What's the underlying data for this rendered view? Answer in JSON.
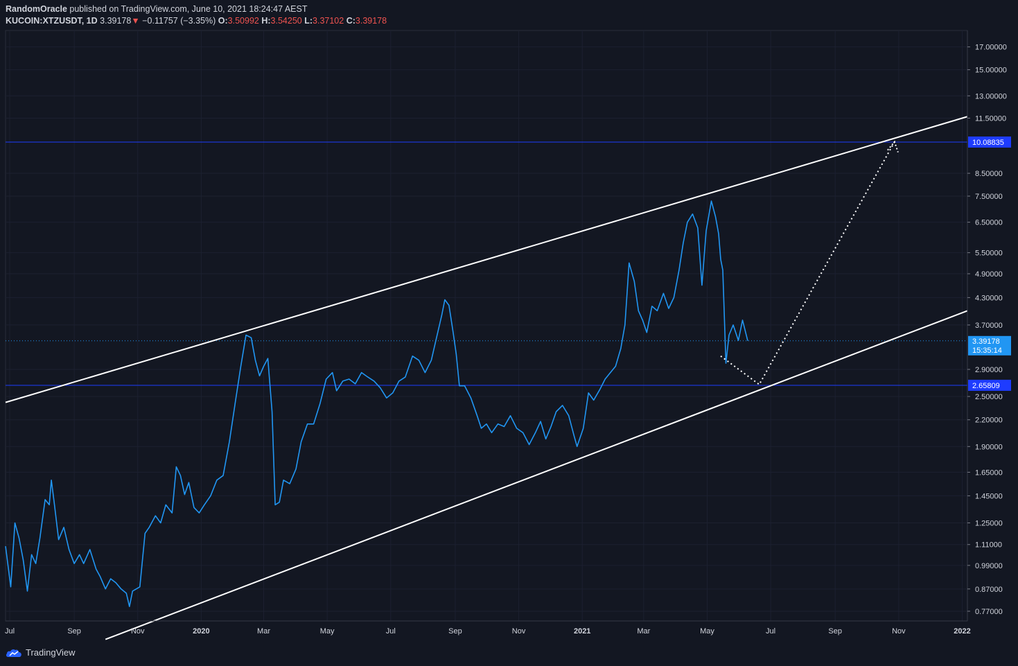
{
  "header": {
    "author": "RandomOracle",
    "published_text": "published on TradingView.com, June 10, 2021 18:24:47 AEST",
    "symbol": "KUCOIN:XTZUSDT, 1D",
    "last": "3.39178",
    "change_arrow": "▼",
    "change": "−0.11757 (−3.35%)",
    "o_label": "O:",
    "o_value": "3.50992",
    "h_label": "H:",
    "h_value": "3.54250",
    "l_label": "L:",
    "l_value": "3.37102",
    "c_label": "C:",
    "c_value": "3.39178"
  },
  "footer": {
    "brand": "TradingView"
  },
  "colors": {
    "background": "#131722",
    "price_line": "#2196f3",
    "horizontal_line": "#1e3cff",
    "channel": "#ffffff",
    "text": "#d1d4dc",
    "red": "#ef5350"
  },
  "chart_data": {
    "type": "line",
    "scale": "log",
    "grid": true,
    "x_ticks": [
      "Jul",
      "Sep",
      "Nov",
      "2020",
      "Mar",
      "May",
      "Jul",
      "Sep",
      "Nov",
      "2021",
      "Mar",
      "May",
      "Jul",
      "Sep",
      "Nov",
      "2022"
    ],
    "x_tick_dates": [
      "2019-07-01",
      "2019-09-01",
      "2019-11-01",
      "2020-01-01",
      "2020-03-01",
      "2020-05-01",
      "2020-07-01",
      "2020-09-01",
      "2020-11-01",
      "2021-01-01",
      "2021-03-01",
      "2021-05-01",
      "2021-07-01",
      "2021-09-01",
      "2021-11-01",
      "2022-01-01"
    ],
    "y_ticks": [
      "17.00000",
      "15.00000",
      "13.00000",
      "11.50000",
      "8.50000",
      "7.50000",
      "6.50000",
      "5.50000",
      "4.90000",
      "4.30000",
      "3.70000",
      "2.90000",
      "2.50000",
      "2.20000",
      "1.90000",
      "1.65000",
      "1.45000",
      "1.25000",
      "1.11000",
      "0.99000",
      "0.87000",
      "0.77000"
    ],
    "x_range": [
      "2019-06-27",
      "2022-01-06"
    ],
    "y_range": [
      0.73,
      18.6
    ],
    "series": [
      {
        "type": "line",
        "points": [
          [
            "2019-06-27",
            1.1
          ],
          [
            "2019-07-02",
            0.88
          ],
          [
            "2019-07-06",
            1.25
          ],
          [
            "2019-07-10",
            1.15
          ],
          [
            "2019-07-14",
            1.02
          ],
          [
            "2019-07-18",
            0.86
          ],
          [
            "2019-07-22",
            1.05
          ],
          [
            "2019-07-26",
            1.0
          ],
          [
            "2019-07-30",
            1.15
          ],
          [
            "2019-08-04",
            1.42
          ],
          [
            "2019-08-08",
            1.38
          ],
          [
            "2019-08-10",
            1.58
          ],
          [
            "2019-08-13",
            1.38
          ],
          [
            "2019-08-17",
            1.14
          ],
          [
            "2019-08-22",
            1.22
          ],
          [
            "2019-08-27",
            1.08
          ],
          [
            "2019-09-01",
            1.0
          ],
          [
            "2019-09-06",
            1.05
          ],
          [
            "2019-09-10",
            1.0
          ],
          [
            "2019-09-16",
            1.08
          ],
          [
            "2019-09-22",
            0.97
          ],
          [
            "2019-09-26",
            0.93
          ],
          [
            "2019-10-01",
            0.87
          ],
          [
            "2019-10-06",
            0.92
          ],
          [
            "2019-10-11",
            0.9
          ],
          [
            "2019-10-16",
            0.87
          ],
          [
            "2019-10-21",
            0.85
          ],
          [
            "2019-10-24",
            0.79
          ],
          [
            "2019-10-27",
            0.86
          ],
          [
            "2019-11-03",
            0.88
          ],
          [
            "2019-11-08",
            1.18
          ],
          [
            "2019-11-12",
            1.22
          ],
          [
            "2019-11-18",
            1.3
          ],
          [
            "2019-11-23",
            1.25
          ],
          [
            "2019-11-28",
            1.38
          ],
          [
            "2019-12-04",
            1.32
          ],
          [
            "2019-12-08",
            1.7
          ],
          [
            "2019-12-12",
            1.62
          ],
          [
            "2019-12-16",
            1.46
          ],
          [
            "2019-12-20",
            1.56
          ],
          [
            "2019-12-25",
            1.36
          ],
          [
            "2019-12-30",
            1.32
          ],
          [
            "2020-01-04",
            1.38
          ],
          [
            "2020-01-10",
            1.45
          ],
          [
            "2020-01-16",
            1.58
          ],
          [
            "2020-01-22",
            1.62
          ],
          [
            "2020-01-28",
            1.95
          ],
          [
            "2020-02-03",
            2.45
          ],
          [
            "2020-02-08",
            2.95
          ],
          [
            "2020-02-13",
            3.5
          ],
          [
            "2020-02-18",
            3.45
          ],
          [
            "2020-02-22",
            3.05
          ],
          [
            "2020-02-26",
            2.8
          ],
          [
            "2020-03-01",
            2.95
          ],
          [
            "2020-03-05",
            3.08
          ],
          [
            "2020-03-09",
            2.3
          ],
          [
            "2020-03-12",
            1.38
          ],
          [
            "2020-03-16",
            1.4
          ],
          [
            "2020-03-20",
            1.58
          ],
          [
            "2020-03-26",
            1.55
          ],
          [
            "2020-04-01",
            1.68
          ],
          [
            "2020-04-06",
            1.95
          ],
          [
            "2020-04-12",
            2.15
          ],
          [
            "2020-04-18",
            2.15
          ],
          [
            "2020-04-24",
            2.4
          ],
          [
            "2020-04-30",
            2.75
          ],
          [
            "2020-05-06",
            2.85
          ],
          [
            "2020-05-10",
            2.58
          ],
          [
            "2020-05-16",
            2.72
          ],
          [
            "2020-05-22",
            2.75
          ],
          [
            "2020-05-28",
            2.68
          ],
          [
            "2020-06-03",
            2.85
          ],
          [
            "2020-06-09",
            2.78
          ],
          [
            "2020-06-15",
            2.72
          ],
          [
            "2020-06-21",
            2.62
          ],
          [
            "2020-06-27",
            2.48
          ],
          [
            "2020-07-03",
            2.55
          ],
          [
            "2020-07-09",
            2.72
          ],
          [
            "2020-07-15",
            2.78
          ],
          [
            "2020-07-22",
            3.12
          ],
          [
            "2020-07-28",
            3.05
          ],
          [
            "2020-08-03",
            2.85
          ],
          [
            "2020-08-09",
            3.05
          ],
          [
            "2020-08-14",
            3.45
          ],
          [
            "2020-08-19",
            3.9
          ],
          [
            "2020-08-22",
            4.25
          ],
          [
            "2020-08-26",
            4.12
          ],
          [
            "2020-08-30",
            3.55
          ],
          [
            "2020-09-02",
            3.15
          ],
          [
            "2020-09-05",
            2.65
          ],
          [
            "2020-09-10",
            2.65
          ],
          [
            "2020-09-16",
            2.48
          ],
          [
            "2020-09-22",
            2.25
          ],
          [
            "2020-09-26",
            2.1
          ],
          [
            "2020-10-01",
            2.15
          ],
          [
            "2020-10-06",
            2.05
          ],
          [
            "2020-10-12",
            2.15
          ],
          [
            "2020-10-18",
            2.12
          ],
          [
            "2020-10-24",
            2.25
          ],
          [
            "2020-10-30",
            2.1
          ],
          [
            "2020-11-05",
            2.05
          ],
          [
            "2020-11-11",
            1.92
          ],
          [
            "2020-11-17",
            2.05
          ],
          [
            "2020-11-22",
            2.18
          ],
          [
            "2020-11-27",
            1.98
          ],
          [
            "2020-12-02",
            2.12
          ],
          [
            "2020-12-07",
            2.3
          ],
          [
            "2020-12-13",
            2.38
          ],
          [
            "2020-12-19",
            2.25
          ],
          [
            "2020-12-24",
            2.02
          ],
          [
            "2020-12-27",
            1.9
          ],
          [
            "2021-01-02",
            2.1
          ],
          [
            "2021-01-07",
            2.55
          ],
          [
            "2021-01-12",
            2.45
          ],
          [
            "2021-01-18",
            2.6
          ],
          [
            "2021-01-23",
            2.75
          ],
          [
            "2021-01-28",
            2.85
          ],
          [
            "2021-02-02",
            2.95
          ],
          [
            "2021-02-07",
            3.25
          ],
          [
            "2021-02-11",
            3.7
          ],
          [
            "2021-02-15",
            5.2
          ],
          [
            "2021-02-20",
            4.7
          ],
          [
            "2021-02-24",
            4.0
          ],
          [
            "2021-02-28",
            3.8
          ],
          [
            "2021-03-04",
            3.55
          ],
          [
            "2021-03-09",
            4.1
          ],
          [
            "2021-03-14",
            4.0
          ],
          [
            "2021-03-20",
            4.4
          ],
          [
            "2021-03-25",
            4.05
          ],
          [
            "2021-03-30",
            4.3
          ],
          [
            "2021-04-04",
            5.0
          ],
          [
            "2021-04-08",
            5.8
          ],
          [
            "2021-04-12",
            6.5
          ],
          [
            "2021-04-17",
            6.8
          ],
          [
            "2021-04-22",
            6.3
          ],
          [
            "2021-04-26",
            4.6
          ],
          [
            "2021-04-30",
            6.2
          ],
          [
            "2021-05-05",
            7.3
          ],
          [
            "2021-05-09",
            6.7
          ],
          [
            "2021-05-12",
            6.1
          ],
          [
            "2021-05-14",
            5.3
          ],
          [
            "2021-05-16",
            5.0
          ],
          [
            "2021-05-19",
            3.0
          ],
          [
            "2021-05-22",
            3.5
          ],
          [
            "2021-05-26",
            3.7
          ],
          [
            "2021-05-31",
            3.4
          ],
          [
            "2021-06-04",
            3.8
          ],
          [
            "2021-06-09",
            3.39178
          ]
        ]
      }
    ],
    "channel_upper": [
      [
        "2019-06-27",
        2.42
      ],
      [
        "2022-01-06",
        11.6
      ]
    ],
    "channel_lower": [
      [
        "2019-10-01",
        0.66
      ],
      [
        "2022-01-06",
        4.0
      ]
    ],
    "projection_path": [
      [
        "2021-05-14",
        3.12
      ],
      [
        "2021-06-20",
        2.67
      ],
      [
        "2021-10-28",
        10.1
      ]
    ],
    "horizontal_levels": [
      {
        "value": 10.08835,
        "label": "10.08835"
      },
      {
        "value": 2.65809,
        "label": "2.65809"
      }
    ],
    "last_price": {
      "value": 3.39178,
      "label": "3.39178",
      "countdown": "15:35:14"
    }
  }
}
